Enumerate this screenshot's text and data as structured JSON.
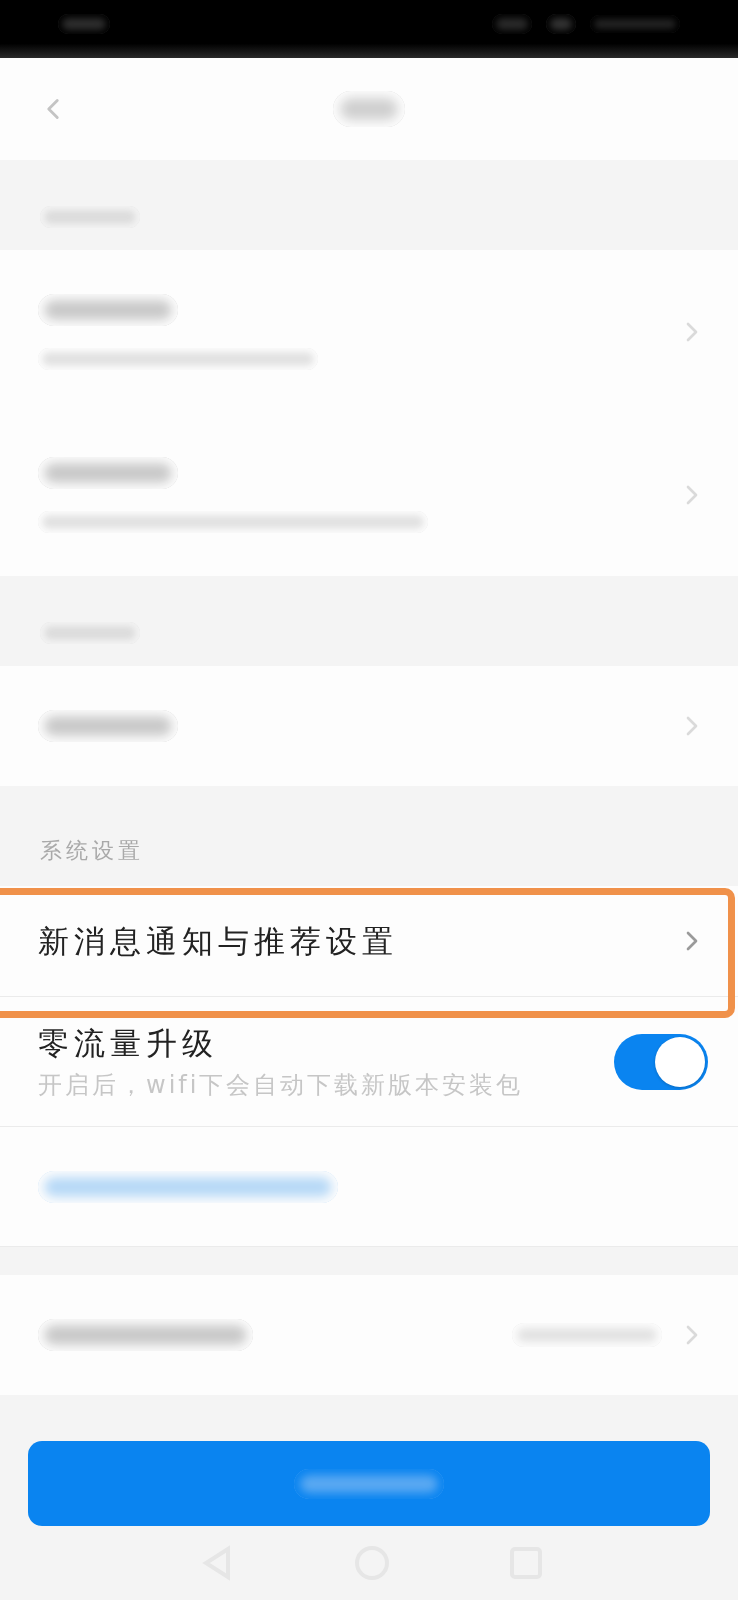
{
  "sections": [
    {
      "header": {
        "kind": "blurred"
      },
      "rows": [
        {
          "kind": "blurred",
          "detail": true,
          "chevron": true
        },
        {
          "kind": "blurred",
          "detail": true,
          "chevron": true
        }
      ]
    },
    {
      "header": {
        "kind": "blurred"
      },
      "rows": [
        {
          "kind": "blurred",
          "detail": false,
          "chevron": true
        }
      ]
    },
    {
      "header": {
        "kind": "text",
        "title": "系统设置"
      },
      "rows": [
        {
          "kind": "link",
          "title": "新消息通知与推荐设置",
          "highlighted": true
        },
        {
          "kind": "toggle",
          "title": "零流量升级",
          "subtitle": "开启后，wifi下会自动下载新版本安装包",
          "on": true
        },
        {
          "kind": "blurred",
          "detail": false,
          "chevron": false,
          "accent": true
        }
      ]
    },
    {
      "rows": [
        {
          "kind": "blurred",
          "detail": false,
          "chevron": true,
          "value": true
        }
      ]
    }
  ]
}
